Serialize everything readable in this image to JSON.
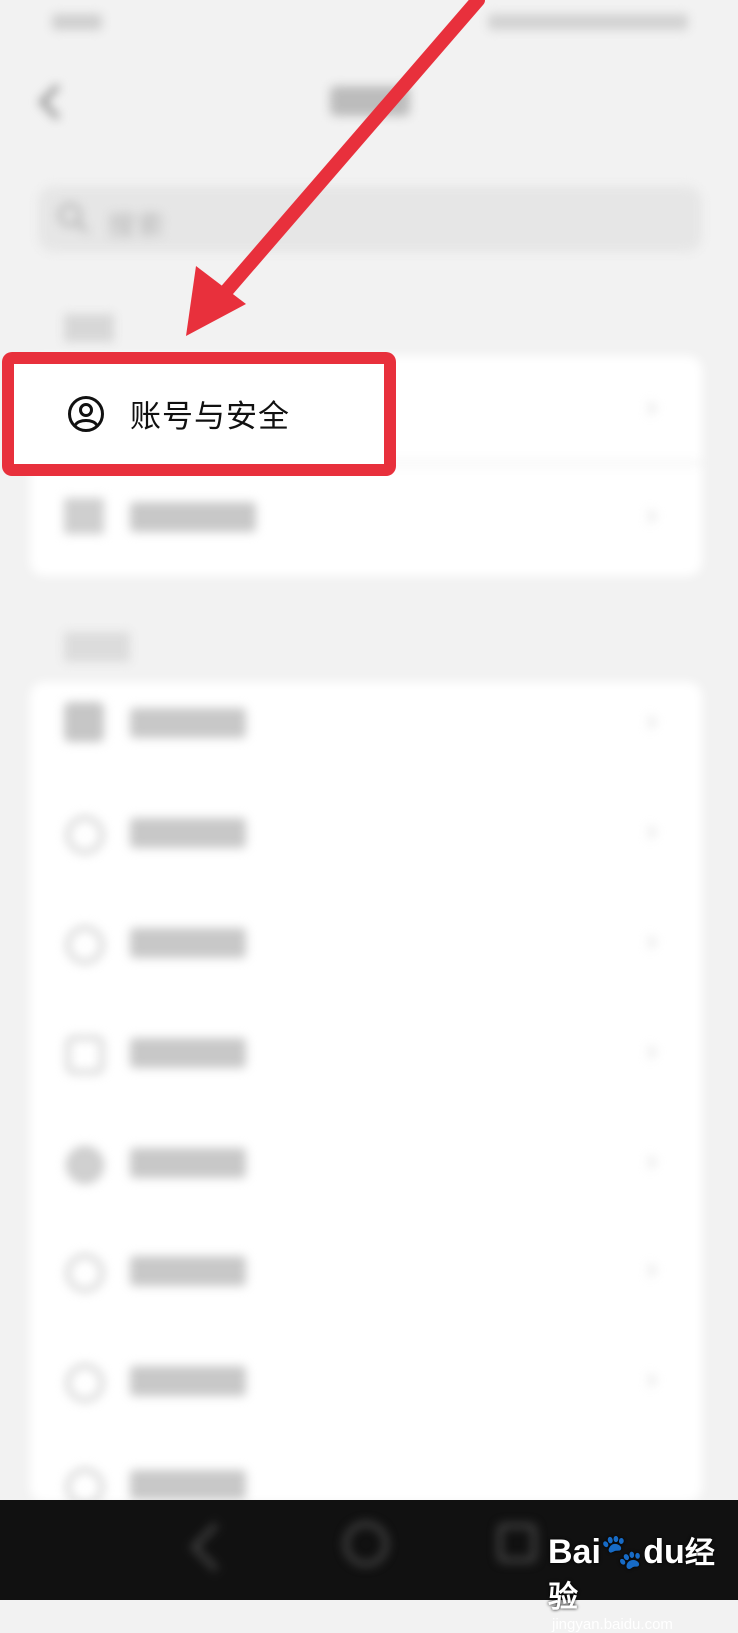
{
  "header": {
    "search_placeholder": "搜索"
  },
  "account_section": {
    "account_security_label": "账号与安全"
  },
  "annotations": {
    "highlight_color": "#e8303c",
    "arrow_color": "#e8303c"
  },
  "icons": {
    "back": "back-arrow-icon",
    "search": "search-icon",
    "account": "user-circle-icon",
    "chevron": "chevron-right-icon"
  },
  "watermark": {
    "brand": "Bai",
    "brand_tail": "du",
    "product": "经验",
    "url": "jingyan.baidu.com"
  }
}
